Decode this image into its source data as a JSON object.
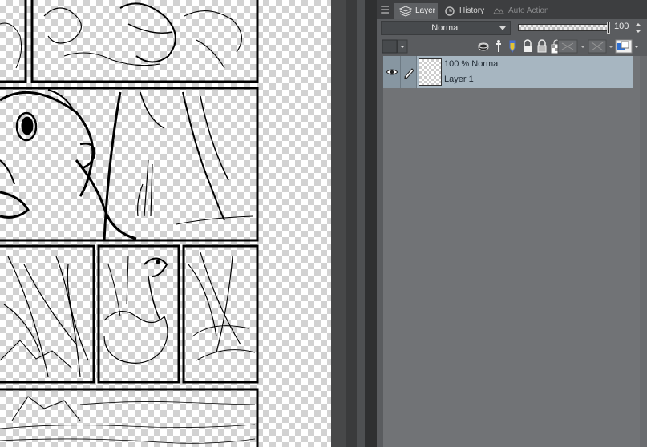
{
  "tabs": [
    {
      "label": "Layer",
      "active": true,
      "icon": "layers-icon"
    },
    {
      "label": "History",
      "active": false,
      "icon": "history-icon"
    },
    {
      "label": "Auto Action",
      "active": false,
      "icon": "auto-action-icon"
    }
  ],
  "toolbar": {
    "blend_mode": "Normal",
    "opacity_value": "100",
    "opacity_fraction": 1.0
  },
  "layers": [
    {
      "opacity_mode": "100 %  Normal",
      "name": "Layer 1",
      "visible": true,
      "selected": true
    }
  ],
  "colors": {
    "panel_bg": "#5a5c5f",
    "list_bg": "#717376",
    "selected_row": "#a7b6c1",
    "tab_bar": "#3d3e40"
  }
}
